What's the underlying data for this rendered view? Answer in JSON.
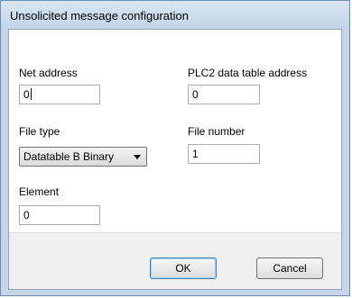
{
  "dialog": {
    "title": "Unsolicited message configuration"
  },
  "fields": {
    "net_address": {
      "label": "Net address",
      "value": "0"
    },
    "plc2_address": {
      "label": "PLC2 data table address",
      "value": "0"
    },
    "file_type": {
      "label": "File type",
      "selected": "Datatable B Binary"
    },
    "file_number": {
      "label": "File number",
      "value": "1"
    },
    "element": {
      "label": "Element",
      "value": "0"
    }
  },
  "buttons": {
    "ok": "OK",
    "cancel": "Cancel"
  },
  "icons": {
    "dropdown": "chevron-down-icon"
  }
}
